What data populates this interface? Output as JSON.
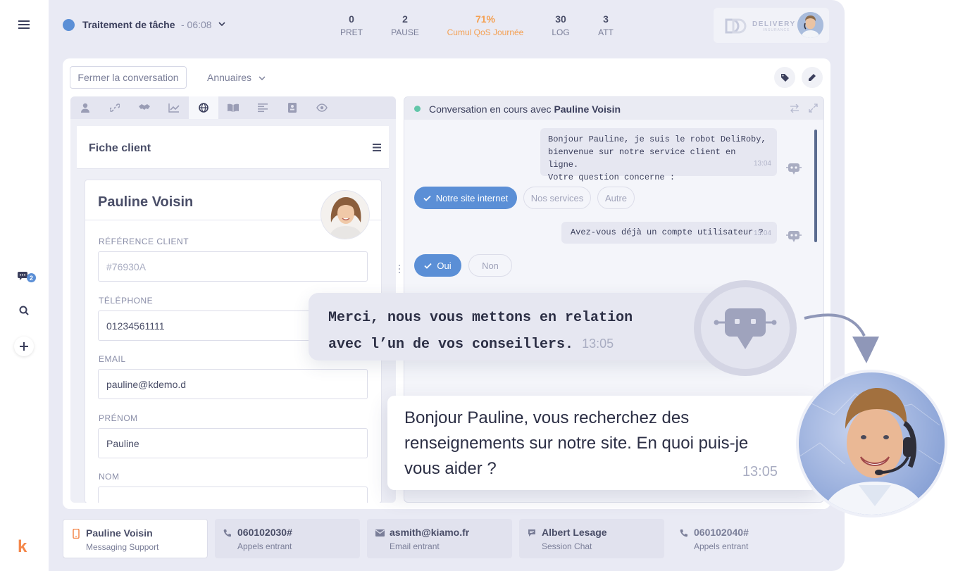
{
  "header": {
    "task_title": "Traitement de tâche",
    "task_time": "- 06:08",
    "stats": [
      {
        "value": "0",
        "label": "PRET"
      },
      {
        "value": "2",
        "label": "PAUSE"
      },
      {
        "value": "71%",
        "label": "Cumul QoS Journée"
      },
      {
        "value": "30",
        "label": "LOG"
      },
      {
        "value": "3",
        "label": "ATT"
      }
    ],
    "logo_text": "DELIVERY",
    "logo_sub": "INSURANCE"
  },
  "sidebar": {
    "chat_badge": "2",
    "brand_letter": "k"
  },
  "toolbar": {
    "close_conversation": "Fermer la conversation",
    "annuaires": "Annuaires"
  },
  "fiche": {
    "title": "Fiche client",
    "client_name": "Pauline Voisin",
    "fields": [
      {
        "label": "RÉFÉRENCE CLIENT",
        "value": "#76930A"
      },
      {
        "label": "TÉLÉPHONE",
        "value": "01234561111"
      },
      {
        "label": "EMAIL",
        "value": "pauline@kdemo.d"
      },
      {
        "label": "PRÉNOM",
        "value": "Pauline"
      },
      {
        "label": "NOM",
        "value": ""
      }
    ]
  },
  "conversation": {
    "header_prefix": "Conversation en cours avec",
    "header_name": "Pauline Voisin",
    "bot_msg_1_lines": [
      "Bonjour Pauline, je suis le robot DeliRoby,",
      "bienvenue sur notre service client en ligne.",
      "Votre question concerne :"
    ],
    "bot_msg_1_time": "13:04",
    "choices_1": [
      "Notre site internet",
      "Nos services",
      "Autre"
    ],
    "bot_msg_2": "Avez-vous déjà un compte utilisateur ?",
    "bot_msg_2_time": "13:04",
    "choices_2": [
      "Oui",
      "Non"
    ]
  },
  "overlay": {
    "bot_text_line1": "Merci, nous vous mettons en relation",
    "bot_text_line2": "avec l’un de vos conseillers.",
    "bot_time": "13:05",
    "agent_text": "Bonjour Pauline, vous recherchez des renseignements sur notre site. En quoi puis-je vous aider ?",
    "agent_time": "13:05"
  },
  "bottom_tabs": [
    {
      "name": "Pauline Voisin",
      "sub": "Messaging Support",
      "icon": "mobile-icon"
    },
    {
      "name": "060102030#",
      "sub": "Appels entrant",
      "icon": "phone-icon"
    },
    {
      "name": "asmith@kiamo.fr",
      "sub": "Email entrant",
      "icon": "envelope-icon"
    },
    {
      "name": "Albert Lesage",
      "sub": "Session Chat",
      "icon": "chat-icon"
    },
    {
      "name": "060102040#",
      "sub": "Appels entrant",
      "icon": "phone-icon"
    }
  ],
  "colors": {
    "accent": "#5b8fd6",
    "qos": "#f4a052",
    "brand": "#f4874a",
    "online": "#62c6a9"
  }
}
